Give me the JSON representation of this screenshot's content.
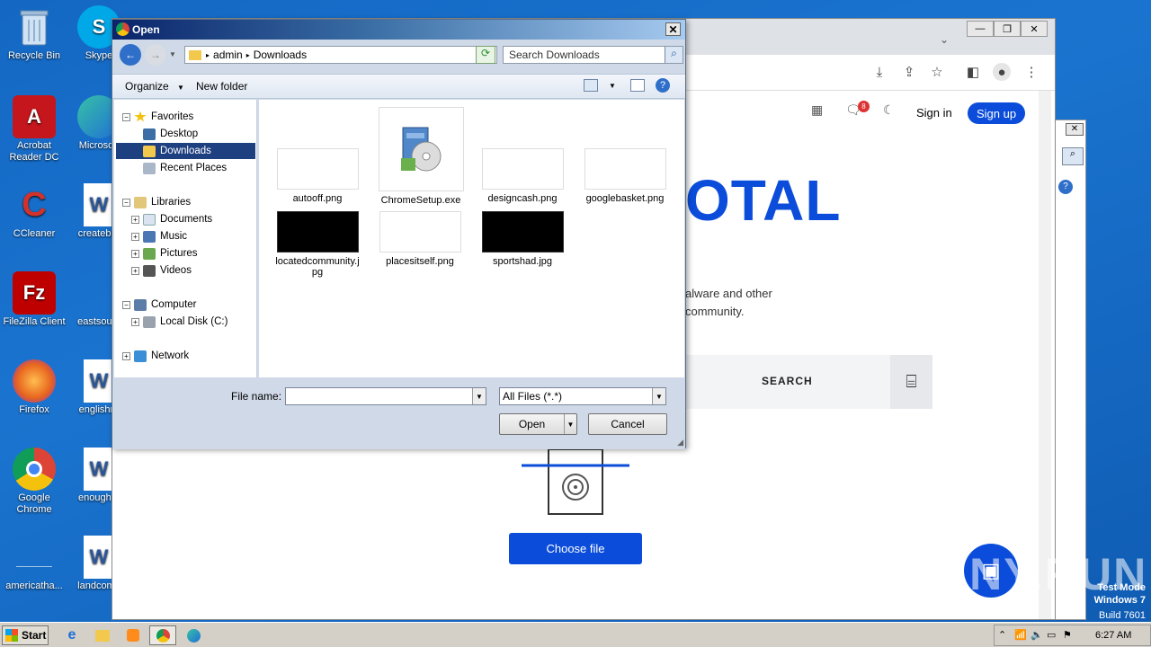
{
  "desktop": {
    "icons": [
      {
        "label": "Recycle Bin",
        "icon": "recycle-bin-icon",
        "color": "#6b8fb5"
      },
      {
        "label": "Acrobat Reader DC",
        "icon": "acrobat-icon",
        "color": "#c4161c"
      },
      {
        "label": "CCleaner",
        "icon": "ccleaner-icon",
        "color": "#d1322b"
      },
      {
        "label": "FileZilla Client",
        "icon": "filezilla-icon",
        "color": "#bf0000"
      },
      {
        "label": "Firefox",
        "icon": "firefox-icon",
        "color": "#e8661f"
      },
      {
        "label": "Google Chrome",
        "icon": "chrome-icon",
        "color": "#2a8a3e"
      },
      {
        "label": "americatha...",
        "icon": "blank-file-icon",
        "color": "#ffffff"
      },
      {
        "label": "Skype",
        "icon": "skype-icon",
        "color": "#00a8e8"
      },
      {
        "label": "Microsoft",
        "icon": "edge-icon",
        "color": "#1f9fd6"
      },
      {
        "label": "createbro",
        "icon": "word-doc-icon",
        "color": "#2b579a"
      },
      {
        "label": "eastsouth",
        "icon": "blank-file-icon",
        "color": "#ffffff"
      },
      {
        "label": "englishre",
        "icon": "word-doc-icon",
        "color": "#2b579a"
      },
      {
        "label": "enoughfo",
        "icon": "word-doc-icon",
        "color": "#2b579a"
      },
      {
        "label": "landcomp",
        "icon": "word-doc-icon",
        "color": "#2b579a"
      }
    ]
  },
  "browser": {
    "nav": {
      "signin": "Sign in",
      "signup": "Sign up",
      "notif_count": "8"
    },
    "hero": "OTAL",
    "desc_line1": "alware and other",
    "desc_line2": "community.",
    "search_label": "SEARCH",
    "choose_file": "Choose file"
  },
  "dialog": {
    "title": "Open",
    "breadcrumb": [
      "admin",
      "Downloads"
    ],
    "search_placeholder": "Search Downloads",
    "commands": {
      "organize": "Organize",
      "new_folder": "New folder"
    },
    "tree": {
      "favorites": "Favorites",
      "desktop": "Desktop",
      "downloads": "Downloads",
      "recent": "Recent Places",
      "libraries": "Libraries",
      "documents": "Documents",
      "music": "Music",
      "pictures": "Pictures",
      "videos": "Videos",
      "computer": "Computer",
      "local_disk": "Local Disk (C:)",
      "network": "Network"
    },
    "files": [
      {
        "name": "autooff.png",
        "thumb": "light"
      },
      {
        "name": "ChromeSetup.exe",
        "thumb": "installer"
      },
      {
        "name": "designcash.png",
        "thumb": "light"
      },
      {
        "name": "googlebasket.png",
        "thumb": "light"
      },
      {
        "name": "locatedcommunity.jpg",
        "thumb": "dark"
      },
      {
        "name": "placesitself.png",
        "thumb": "light"
      },
      {
        "name": "sportshad.jpg",
        "thumb": "dark"
      }
    ],
    "file_name_label": "File name:",
    "file_name_value": "",
    "filter": "All Files (*.*)",
    "open_label": "Open",
    "cancel_label": "Cancel"
  },
  "taskbar": {
    "start": "Start",
    "time": "6:27 AM"
  },
  "watermark": {
    "line1": "Test Mode",
    "line2": "Windows 7",
    "line3": "Build 7601",
    "anyrun": "ANY.RUN"
  }
}
